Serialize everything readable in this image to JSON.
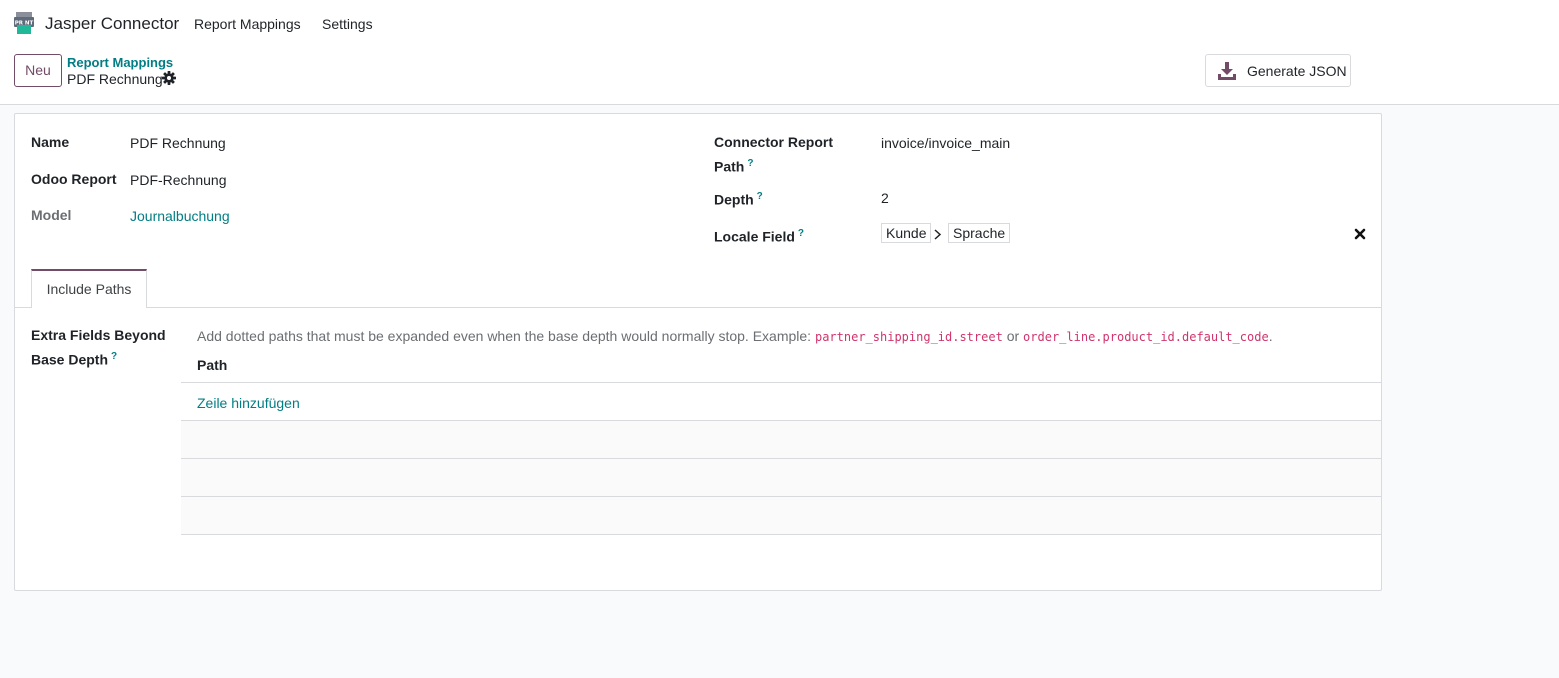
{
  "app": {
    "name": "Jasper Connector",
    "icon": "print-icon",
    "menu": [
      "Report Mappings",
      "Settings"
    ]
  },
  "control_panel": {
    "new_label": "Neu",
    "breadcrumb_parent": "Report Mappings",
    "breadcrumb_current": "PDF Rechnung",
    "generate_label": "Generate JSON"
  },
  "form": {
    "left": {
      "name_label": "Name",
      "name_value": "PDF Rechnung",
      "report_label": "Odoo Report",
      "report_value": "PDF-Rechnung",
      "model_label": "Model",
      "model_value": "Journalbuchung"
    },
    "right": {
      "path_label_1": "Connector Report",
      "path_label_2": "Path",
      "path_value": "invoice/invoice_main",
      "depth_label": "Depth",
      "depth_value": "2",
      "locale_label": "Locale Field",
      "locale_tags": [
        "Kunde",
        "Sprache"
      ]
    },
    "help_mark": "?"
  },
  "tabs": [
    "Include Paths"
  ],
  "include_paths": {
    "label_1": "Extra Fields Beyond",
    "label_2": "Base Depth",
    "description_text": "Add dotted paths that must be expanded even when the base depth would normally stop. Example:",
    "example_1": "partner_shipping_id.street",
    "or_text": "or",
    "example_2": "order_line.product_id.default_code",
    "period": ".",
    "column_header": "Path",
    "add_line": "Zeile hinzufügen"
  },
  "colors": {
    "brand": "#714b67",
    "link": "#017e84",
    "code": "#d0346d"
  }
}
